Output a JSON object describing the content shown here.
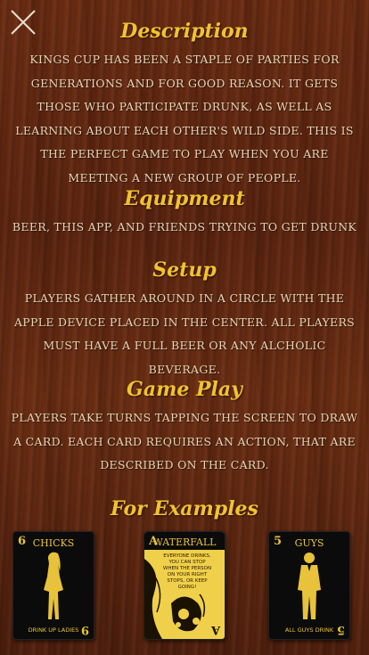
{
  "close_label": "Close",
  "sections": {
    "description": {
      "heading": "Description",
      "body": "Kings cup has been a staple of parties for generations and for good reason. It gets those who participate drunk, as well as learning about each other's wild side. This is the perfect game to play when you are meeting a new group of people."
    },
    "equipment": {
      "heading": "Equipment",
      "body": "Beer, this app, and friends trying to get drunk"
    },
    "setup": {
      "heading": "Setup",
      "body": "Players gather around in a circle with the apple device placed in the center.  All players must have a full beer or any alcholic beverage."
    },
    "gameplay": {
      "heading": "Game Play",
      "body": "Players take turns tapping the screen to draw a card. Each card requires an action, that are described on the card."
    },
    "examples": {
      "heading": "For Examples"
    }
  },
  "cards": [
    {
      "rank": "6",
      "title": "Chicks",
      "rule": "Drink up ladies",
      "rank_bottom": "9"
    },
    {
      "rank": "A",
      "title": "Waterfall",
      "rule": "Everyone drinks. You can stop when the person on your right stops, or keep going!",
      "rank_bottom": "A"
    },
    {
      "rank": "5",
      "title": "Guys",
      "rule": "All guys drink",
      "rank_bottom": "5"
    }
  ],
  "colors": {
    "heading": "#f2c230",
    "body_text": "#e6d6b8",
    "card_gold": "#e8c23a"
  }
}
